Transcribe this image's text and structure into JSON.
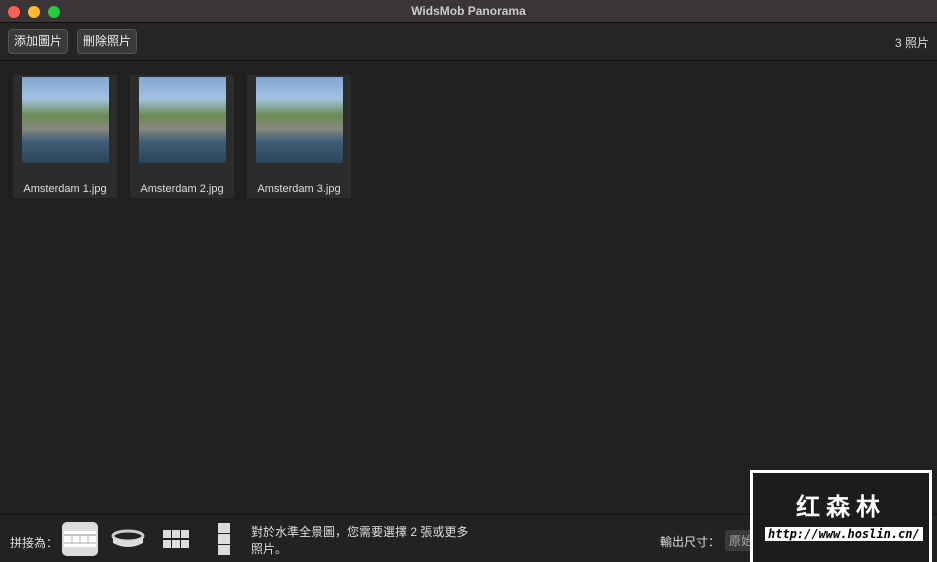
{
  "window": {
    "title": "WidsMob Panorama"
  },
  "toolbar": {
    "add_label": "添加圖片",
    "delete_label": "刪除照片",
    "count": "3 照片"
  },
  "photos": [
    {
      "name": "Amsterdam 1.jpg"
    },
    {
      "name": "Amsterdam 2.jpg"
    },
    {
      "name": "Amsterdam 3.jpg"
    }
  ],
  "bottom": {
    "stitch_label": "拼接為：",
    "modes": [
      "horizontal",
      "360",
      "grid",
      "vertical"
    ],
    "selected_mode": "horizontal",
    "hint": "對於水準全景圖，您需要選擇 2 張或更多照片。",
    "output_label": "輸出尺寸：",
    "output_value": "原始尺寸"
  },
  "watermark": {
    "text": "红森林",
    "url": "http://www.hoslin.cn/"
  }
}
